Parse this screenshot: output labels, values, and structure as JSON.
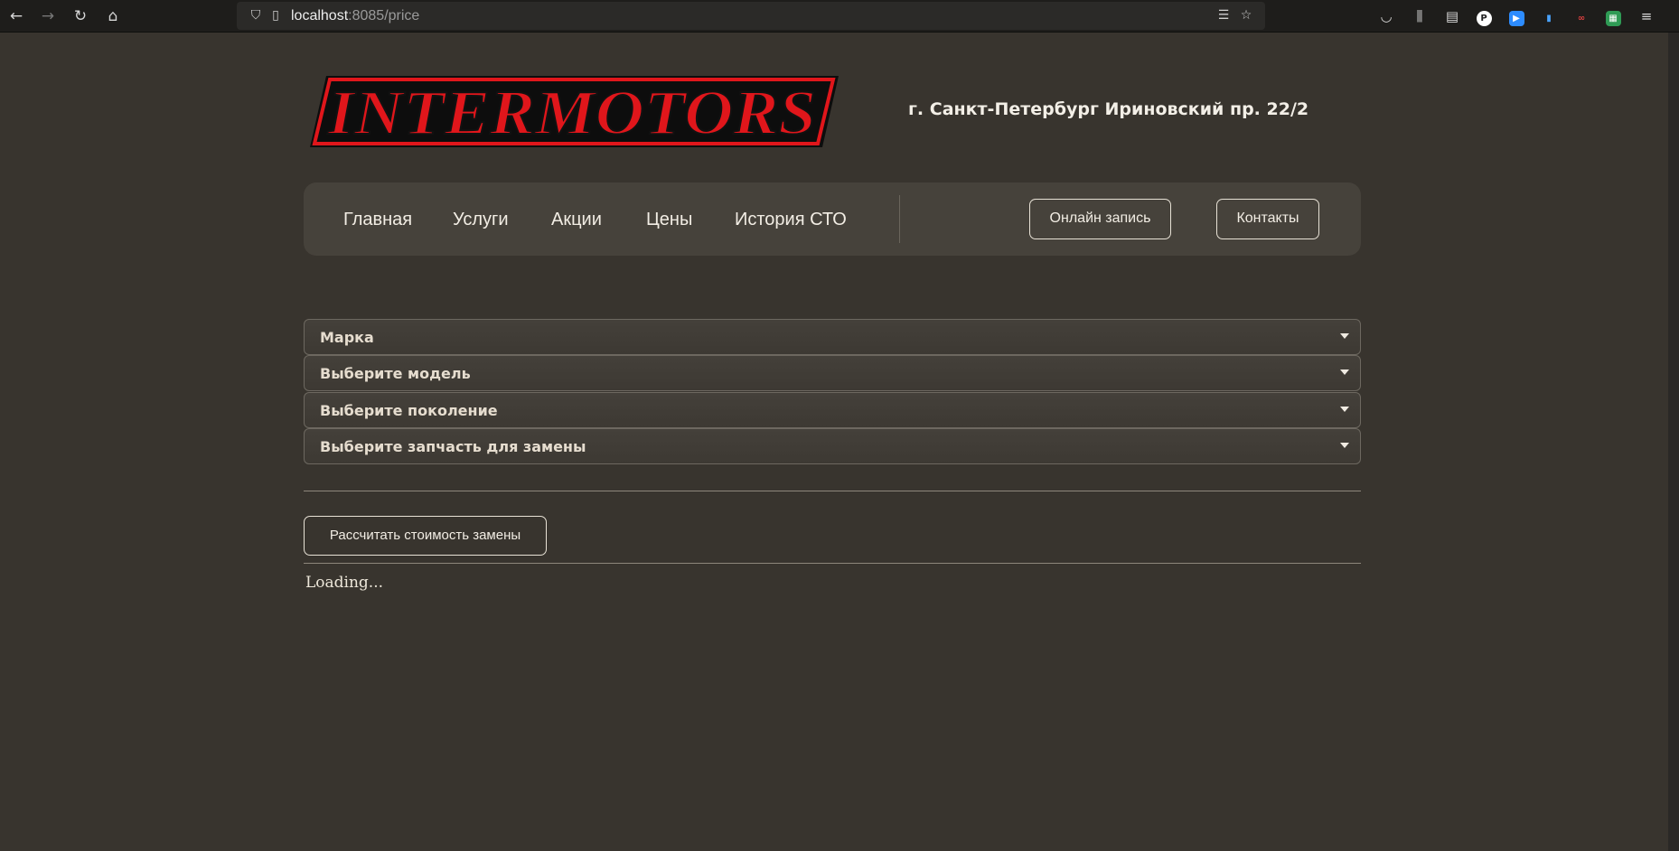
{
  "browser": {
    "url_host": "localhost",
    "url_rest": ":8085/price"
  },
  "header": {
    "logo_text": "INTERMOTORS",
    "address": "г. Санкт-Петербург Ириновский пр. 22/2"
  },
  "nav": {
    "links": [
      "Главная",
      "Услуги",
      "Акции",
      "Цены",
      "История СТО"
    ],
    "online_booking": "Онлайн запись",
    "contacts": "Контакты"
  },
  "form": {
    "dropdowns": [
      "Марка",
      "Выберите модель",
      "Выберите поколение",
      "Выберите запчасть для замены"
    ],
    "calc_button": "Рассчитать стоимость замены",
    "status": "Loading..."
  },
  "colors": {
    "background": "#38342e",
    "navbar": "#46423b",
    "logo_red": "#e0161b"
  }
}
